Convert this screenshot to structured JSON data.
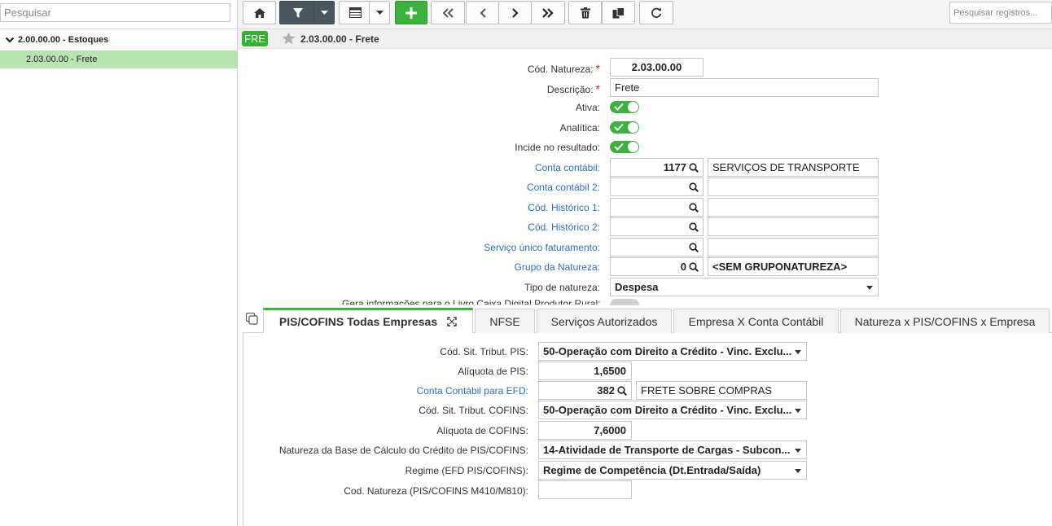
{
  "sidebar": {
    "search_placeholder": "Pesquisar",
    "tree_parent": "2.00.00.00 - Estoques",
    "tree_child": "2.03.00.00 - Frete"
  },
  "toolbar": {
    "search_placeholder": "Pesquisar registros..."
  },
  "titlebar": {
    "badge": "FRE",
    "title": "2.03.00.00 - Frete"
  },
  "form": {
    "cod_natureza": {
      "label": "Cód. Natureza:",
      "value": "2.03.00.00"
    },
    "descricao": {
      "label": "Descrição:",
      "value": "Frete"
    },
    "ativa": {
      "label": "Ativa:"
    },
    "analitica": {
      "label": "Analítica:"
    },
    "incide": {
      "label": "Incide no resultado:"
    },
    "conta_contabil": {
      "label": "Conta contábil:",
      "code": "1177",
      "desc": "SERVIÇOS DE TRANSPORTE"
    },
    "conta_contabil2": {
      "label": "Conta contábil 2:",
      "code": "",
      "desc": ""
    },
    "cod_historico1": {
      "label": "Cód. Histórico 1:",
      "code": "",
      "desc": ""
    },
    "cod_historico2": {
      "label": "Cód. Histórico 2:",
      "code": "",
      "desc": ""
    },
    "servico_unico": {
      "label": "Serviço único faturamento:",
      "code": "",
      "desc": ""
    },
    "grupo_natureza": {
      "label": "Grupo da Natureza:",
      "code": "0",
      "desc": "<SEM GRUPONATUREZA>"
    },
    "tipo_natureza": {
      "label": "Tipo de natureza:",
      "value": "Despesa"
    },
    "cut_label": "Gera informações para o Livro Caixa Digital Produtor Rural:"
  },
  "tabs": [
    {
      "label": "PIS/COFINS Todas Empresas"
    },
    {
      "label": "NFSE"
    },
    {
      "label": "Serviços Autorizados"
    },
    {
      "label": "Empresa X Conta Contábil"
    },
    {
      "label": "Natureza x PIS/COFINS x Empresa"
    }
  ],
  "pis": {
    "cst_pis": {
      "label": "Cód. Sit. Tribut. PIS:",
      "value": "50-Operação com Direito a Crédito - Vinc. Exclu..."
    },
    "aliq_pis": {
      "label": "Alíquota de PIS:",
      "value": "1,6500"
    },
    "conta_efd": {
      "label": "Conta Contábil para EFD:",
      "code": "382",
      "desc": "FRETE SOBRE COMPRAS"
    },
    "cst_cofins": {
      "label": "Cód. Sit. Tribut. COFINS:",
      "value": "50-Operação com Direito a Crédito - Vinc. Exclu..."
    },
    "aliq_cofins": {
      "label": "Alíquota de COFINS:",
      "value": "7,6000"
    },
    "natureza_base": {
      "label": "Natureza da Base de Cálculo do Crédito de PIS/COFINS:",
      "value": "14-Atividade de Transporte de Cargas - Subcon..."
    },
    "regime": {
      "label": "Regime (EFD PIS/COFINS):",
      "value": "Regime de Competência (Dt.Entrada/Saída)"
    },
    "cod_nat_pc": {
      "label": "Cod. Natureza (PIS/COFINS M410/M810):",
      "value": ""
    }
  }
}
